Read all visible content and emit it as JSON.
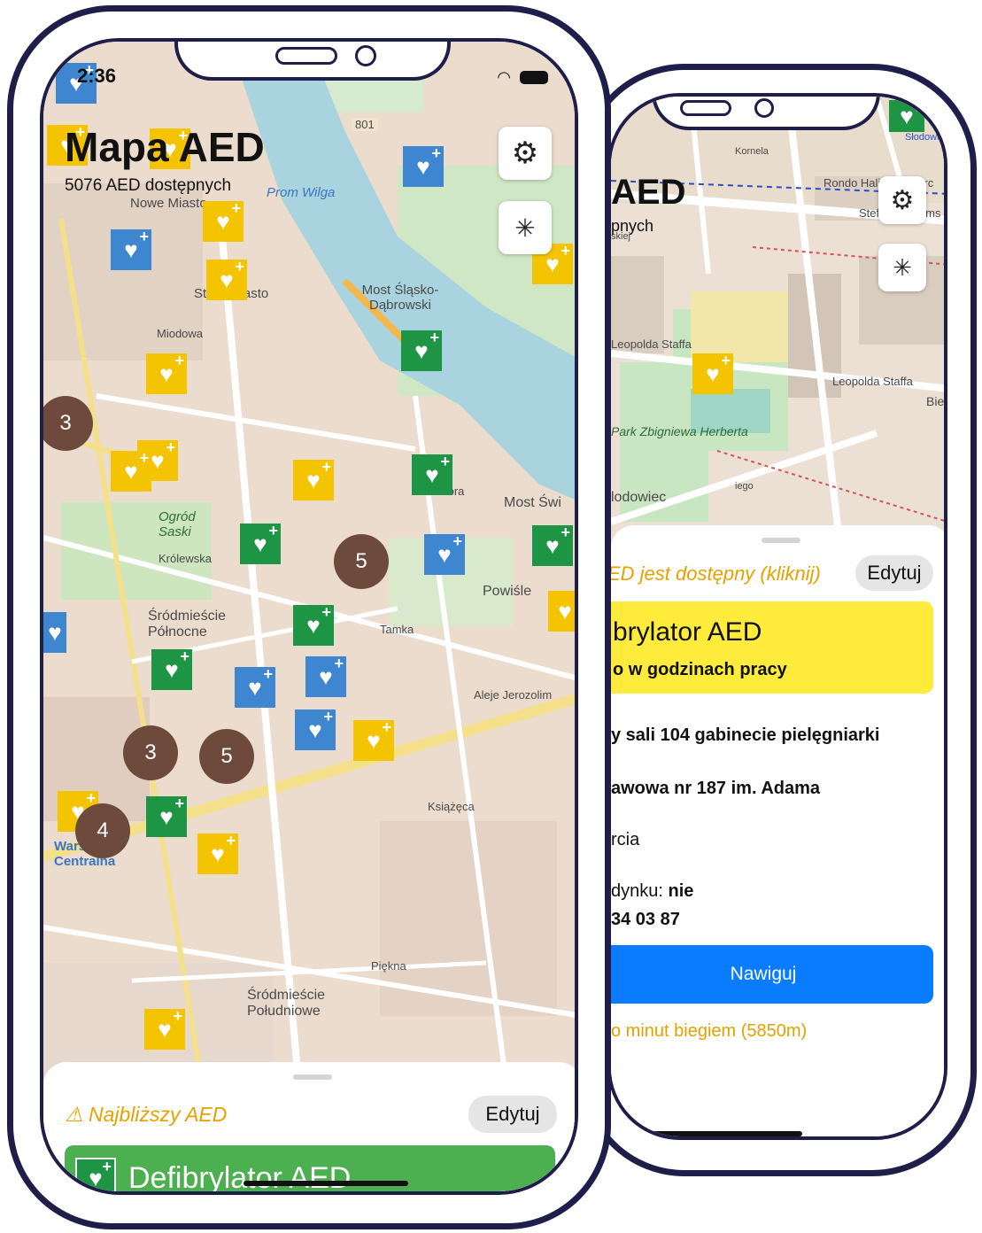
{
  "colors": {
    "frame": "#1f1d4a",
    "aed_yellow": "#f5c400",
    "aed_green": "#1e9445",
    "aed_blue": "#3f86d1",
    "cluster": "#6e4a3c",
    "water": "#a9d3df",
    "accent_blue": "#0a7cff",
    "warn_orange": "#e5a100",
    "sheet_green": "#4caf50",
    "sheet_yellow": "#ffeb3b"
  },
  "front": {
    "status": {
      "time": "2:36"
    },
    "title": "Mapa AED",
    "subtitle": "5076 AED dostępnych",
    "buttons": {
      "settings_icon": "gear-icon",
      "magic_icon": "magic-wand-icon"
    },
    "map_labels": {
      "l1": "Nowe Miasto",
      "l2": "Stare Miasto",
      "l3": "Most Śląsko-Dąbrowski",
      "l4": "Prom Wilga",
      "l5": "Ogród Saski",
      "l6": "Śródmieście Północne",
      "l7": "Powiśle",
      "l8": "Most Świ",
      "l9": "Warszawa Centralna",
      "l10": "Śródmieście Południowe",
      "l11": "801",
      "l12": "Królewska",
      "l13": "Tamka",
      "l14": "Aleje Jerozolim",
      "l15": "Książęca",
      "l16": "Piękna",
      "l17": "Miodowa",
      "l18": "Dobra"
    },
    "clusters": {
      "c1": "3",
      "c2": "5",
      "c3": "3",
      "c4": "5",
      "c5": "4"
    },
    "sheet": {
      "warning": "⚠ Najbliższy AED",
      "edit": "Edytuj",
      "card_title": "Defibrylator AED"
    }
  },
  "back": {
    "title": "AED",
    "subtitle": "pnych",
    "map_labels": {
      "l1": "Rondo Haliny Szwarc",
      "l2": "Stefana Żeroms",
      "l3": "Leopolda Staffa",
      "l4": "Leopolda Staffa",
      "l5": "Park Zbigniewa Herberta",
      "l6": "lodowiec",
      "l7": "Biel Przez",
      "l8": "Kornela",
      "l9": "skiej",
      "l10": "iego",
      "l11": "Słodowiec"
    },
    "sheet": {
      "warning": "ED jest dostępny (kliknij)",
      "edit": "Edytuj",
      "card_title": "brylator AED",
      "card_subtitle": "o w godzinach pracy",
      "line1": "y sali 104 gabinecie pielęgniarki",
      "line2": "awowa nr 187 im. Adama",
      "line3": "rcia",
      "line4_label": "dynku: ",
      "line4_value": "nie",
      "line5": "34 03 87",
      "navigate": "Nawiguj",
      "distance": "o minut biegiem (5850m)"
    }
  }
}
